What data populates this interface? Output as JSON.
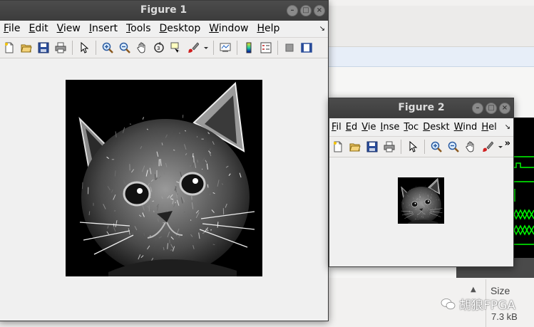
{
  "background": {
    "footer": {
      "size_label": "Size",
      "size_value": "7.3 kB",
      "sort_arrow": "▲"
    },
    "watermark": "胡狼FPGA"
  },
  "figure1": {
    "title": "Figure 1",
    "window_buttons": {
      "minimize": "–",
      "maximize": "□",
      "close": "×"
    },
    "menu": [
      {
        "label": "File",
        "u": "F",
        "rest": "ile"
      },
      {
        "label": "Edit",
        "u": "E",
        "rest": "dit"
      },
      {
        "label": "View",
        "u": "V",
        "rest": "iew"
      },
      {
        "label": "Insert",
        "u": "I",
        "rest": "nsert"
      },
      {
        "label": "Tools",
        "u": "T",
        "rest": "ools"
      },
      {
        "label": "Desktop",
        "u": "D",
        "rest": "esktop"
      },
      {
        "label": "Window",
        "u": "W",
        "rest": "indow"
      },
      {
        "label": "Help",
        "u": "H",
        "rest": "elp"
      }
    ],
    "menu_more": "↘",
    "toolbar": [
      "new-figure-icon",
      "open-file-icon",
      "save-icon",
      "print-icon",
      "sep",
      "pointer-icon",
      "sep",
      "zoom-in-icon",
      "zoom-out-icon",
      "pan-hand-icon",
      "rotate-3d-icon",
      "data-cursor-icon",
      "brush-icon",
      "dropdown-arrow-icon",
      "sep",
      "link-plot-icon",
      "sep",
      "colorbar-icon",
      "legend-icon",
      "sep",
      "hide-plot-tools-icon",
      "show-plot-tools-icon"
    ]
  },
  "figure2": {
    "title": "Figure 2",
    "window_buttons": {
      "minimize": "–",
      "maximize": "□",
      "close": "×"
    },
    "menu": [
      {
        "label": "Fil",
        "u": "F",
        "rest": "il"
      },
      {
        "label": "Ed",
        "u": "E",
        "rest": "d"
      },
      {
        "label": "Vie",
        "u": "V",
        "rest": "ie"
      },
      {
        "label": "Inse",
        "u": "I",
        "rest": "nse"
      },
      {
        "label": "Toc",
        "u": "T",
        "rest": "oc"
      },
      {
        "label": "Deskt",
        "u": "D",
        "rest": "eskt"
      },
      {
        "label": "Wind",
        "u": "W",
        "rest": "ind"
      },
      {
        "label": "Hel",
        "u": "H",
        "rest": "el"
      }
    ],
    "menu_more": "↘",
    "toolbar_more": "»",
    "toolbar": [
      "new-figure-icon",
      "open-file-icon",
      "save-icon",
      "print-icon",
      "sep",
      "pointer-icon",
      "sep",
      "zoom-in-icon",
      "zoom-out-icon",
      "pan-hand-icon",
      "brush-icon",
      "dropdown-arrow-icon"
    ]
  },
  "colors": {
    "titlebar": "#3f3f3f",
    "waveform": "#00ff00",
    "window_bg": "#f0f0f0"
  }
}
